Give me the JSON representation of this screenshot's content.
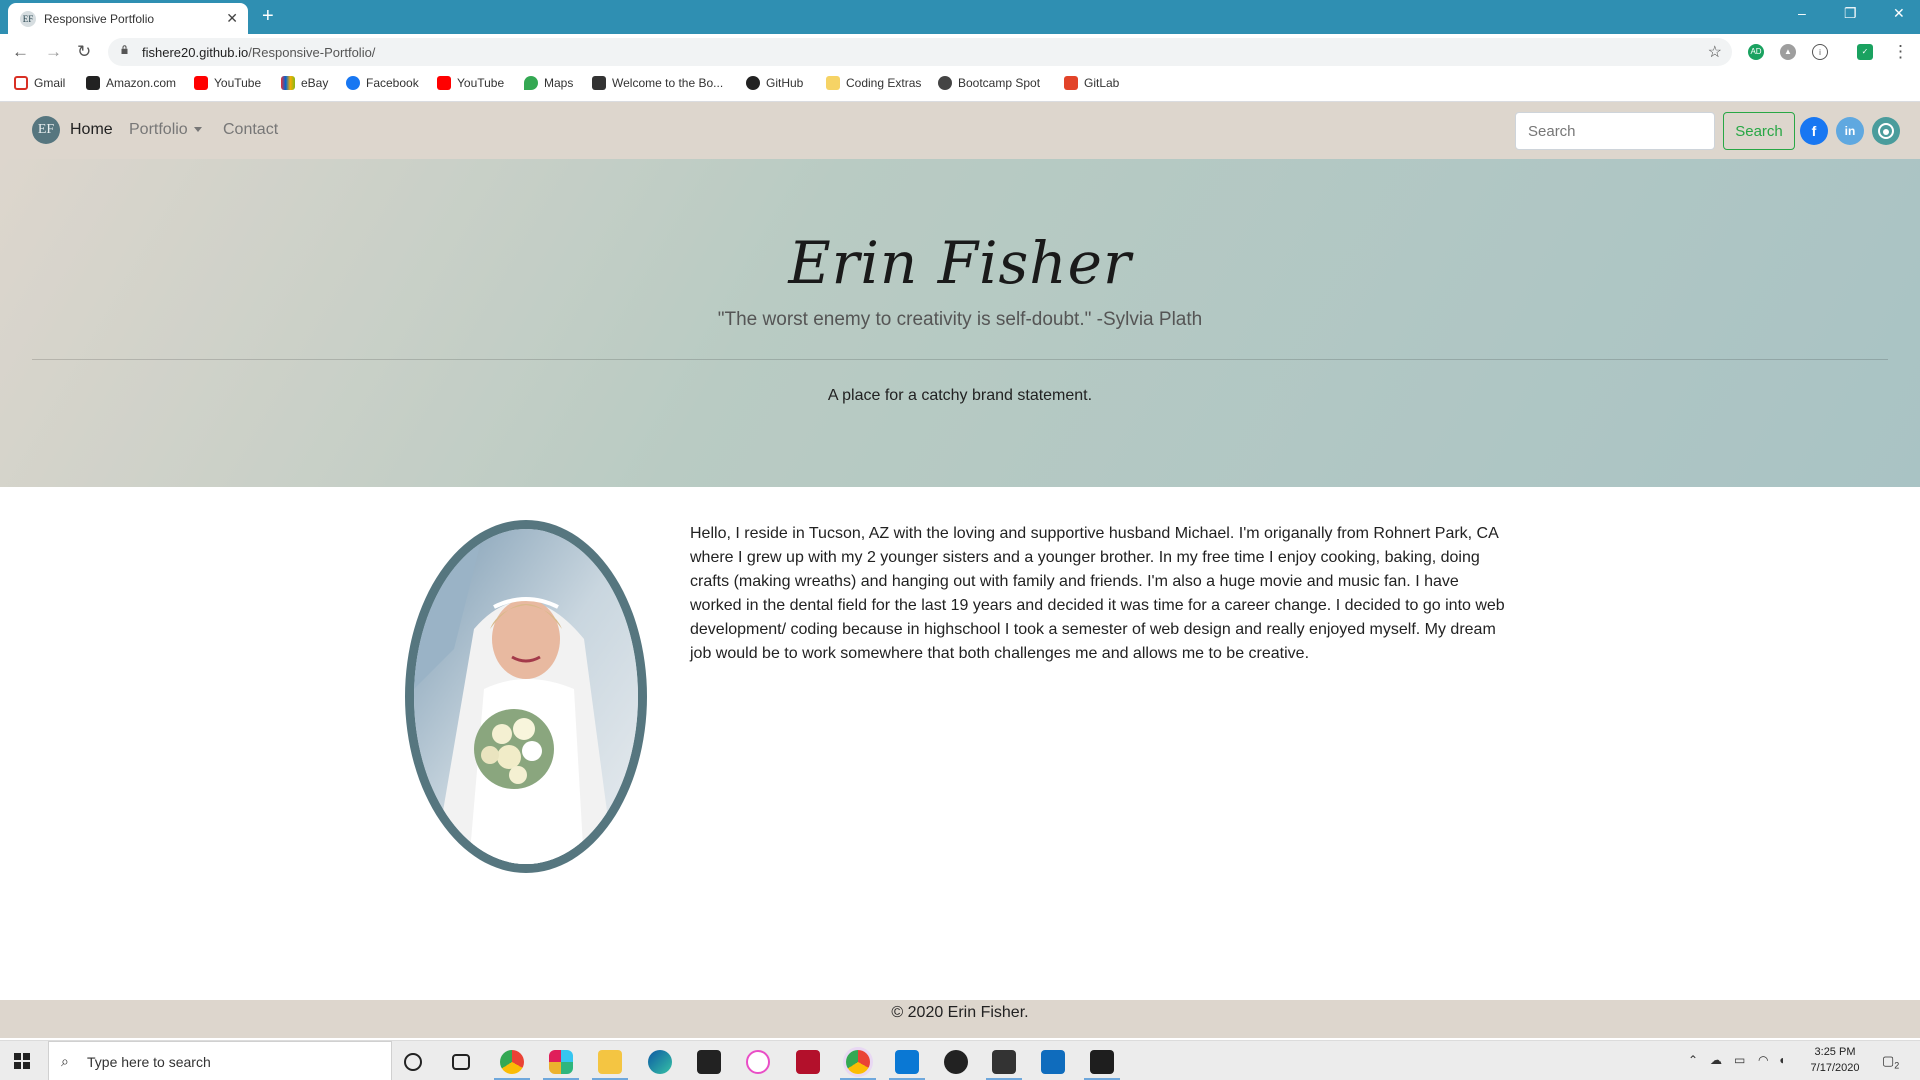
{
  "browser": {
    "tab_title": "Responsive Portfolio",
    "tab_favicon": "EF",
    "url_host": "fishere20.github.io",
    "url_path": "/Responsive-Portfolio/",
    "bookmarks": [
      {
        "label": "Gmail",
        "icon": "gmail-icon",
        "color": "#d93025"
      },
      {
        "label": "Amazon.com",
        "icon": "amazon-icon",
        "color": "#222222"
      },
      {
        "label": "YouTube",
        "icon": "youtube-icon",
        "color": "#ff0000"
      },
      {
        "label": "eBay",
        "icon": "ebay-icon",
        "color": "#e53238"
      },
      {
        "label": "Facebook",
        "icon": "facebook-icon",
        "color": "#1877f2"
      },
      {
        "label": "YouTube",
        "icon": "youtube-icon",
        "color": "#ff0000"
      },
      {
        "label": "Maps",
        "icon": "maps-icon",
        "color": "#34a853"
      },
      {
        "label": "Welcome to the Bo...",
        "icon": "book-icon",
        "color": "#333333"
      },
      {
        "label": "GitHub",
        "icon": "github-icon",
        "color": "#222222"
      },
      {
        "label": "Coding Extras",
        "icon": "folder-icon",
        "color": "#f6d365"
      },
      {
        "label": "Bootcamp Spot",
        "icon": "bootcamp-icon",
        "color": "#444444"
      },
      {
        "label": "GitLab",
        "icon": "gitlab-icon",
        "color": "#e24329"
      }
    ]
  },
  "site": {
    "brand": "EF",
    "nav": {
      "home": "Home",
      "portfolio": "Portfolio",
      "contact": "Contact"
    },
    "search_placeholder": "Search",
    "search_button": "Search",
    "social": {
      "facebook": "f",
      "linkedin": "in"
    },
    "hero": {
      "name": "Erin Fisher",
      "quote": "\"The worst enemy to creativity is self-doubt.\" -Sylvia Plath",
      "statement": "A place for a catchy brand statement."
    },
    "about": "Hello, I reside in Tucson, AZ with the loving and supportive husband Michael. I'm origanally from Rohnert Park, CA where I grew up with my 2 younger sisters and a younger brother. In my free time I enjoy cooking, baking, doing crafts (making wreaths) and hanging out with family and friends. I'm also a huge movie and music fan. I have worked in the dental field for the last 19 years and decided it was time for a career change. I decided to go into web development/ coding because in highschool I took a semester of web design and really enjoyed myself. My dream job would be to work somewhere that both challenges me and allows me to be creative.",
    "footer": "© 2020 Erin Fisher."
  },
  "colors": {
    "accent": "#56767f",
    "nav_bg": "#ddd6cd",
    "search_green": "#28a745",
    "facebook": "#1877f2",
    "linkedin": "#5fa8e0",
    "github": "#4a9c9c"
  },
  "taskbar": {
    "search_placeholder": "Type here to search",
    "time": "3:25 PM",
    "date": "7/17/2020",
    "notifications": "2"
  }
}
